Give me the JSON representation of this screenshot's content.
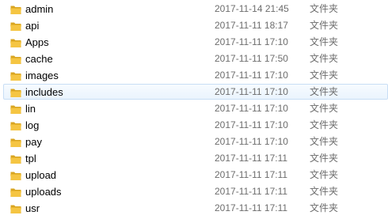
{
  "colors": {
    "folder_front": "#f5c542",
    "folder_back": "#d9a520",
    "hover_border": "#c8def5",
    "meta_text": "#6d6d6d"
  },
  "file_list": {
    "rows": [
      {
        "name": "admin",
        "modified": "2017-11-14 21:45",
        "type": "文件夹",
        "icon": "folder-icon",
        "highlighted": false
      },
      {
        "name": "api",
        "modified": "2017-11-11 18:17",
        "type": "文件夹",
        "icon": "folder-icon",
        "highlighted": false
      },
      {
        "name": "Apps",
        "modified": "2017-11-11 17:10",
        "type": "文件夹",
        "icon": "folder-icon",
        "highlighted": false
      },
      {
        "name": "cache",
        "modified": "2017-11-11 17:50",
        "type": "文件夹",
        "icon": "folder-icon",
        "highlighted": false
      },
      {
        "name": "images",
        "modified": "2017-11-11 17:10",
        "type": "文件夹",
        "icon": "folder-icon",
        "highlighted": false
      },
      {
        "name": "includes",
        "modified": "2017-11-11 17:10",
        "type": "文件夹",
        "icon": "folder-icon",
        "highlighted": true
      },
      {
        "name": "lin",
        "modified": "2017-11-11 17:10",
        "type": "文件夹",
        "icon": "folder-icon",
        "highlighted": false
      },
      {
        "name": "log",
        "modified": "2017-11-11 17:10",
        "type": "文件夹",
        "icon": "folder-icon",
        "highlighted": false
      },
      {
        "name": "pay",
        "modified": "2017-11-11 17:10",
        "type": "文件夹",
        "icon": "folder-icon",
        "highlighted": false
      },
      {
        "name": "tpl",
        "modified": "2017-11-11 17:11",
        "type": "文件夹",
        "icon": "folder-icon",
        "highlighted": false
      },
      {
        "name": "upload",
        "modified": "2017-11-11 17:11",
        "type": "文件夹",
        "icon": "folder-icon",
        "highlighted": false
      },
      {
        "name": "uploads",
        "modified": "2017-11-11 17:11",
        "type": "文件夹",
        "icon": "folder-icon",
        "highlighted": false
      },
      {
        "name": "usr",
        "modified": "2017-11-11 17:11",
        "type": "文件夹",
        "icon": "folder-icon",
        "highlighted": false
      }
    ]
  }
}
